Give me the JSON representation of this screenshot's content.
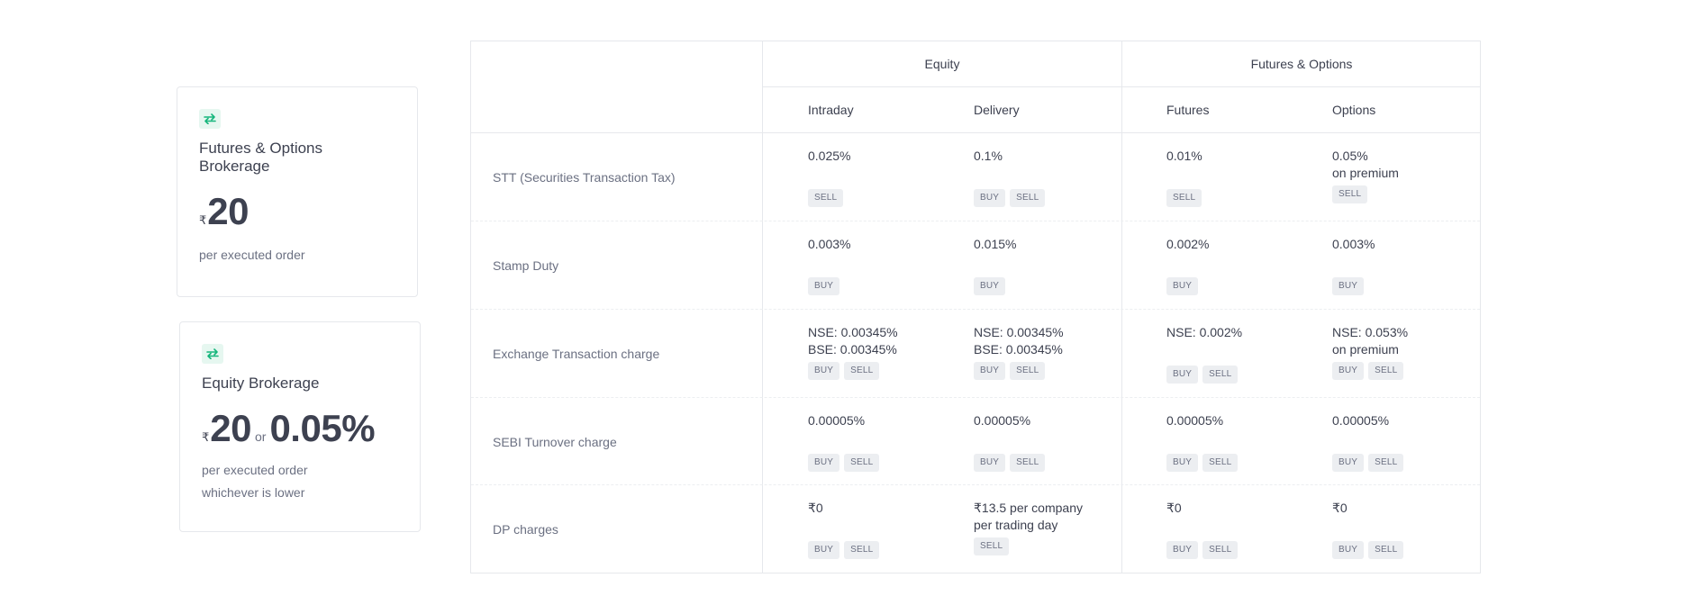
{
  "colors": {
    "accent": "#16b67c",
    "icon_bg": "#e6f7f0",
    "text": "#3d4150",
    "muted": "#6b7082",
    "tag_bg": "#eceef1"
  },
  "cards": {
    "fo": {
      "icon": "swap-arrows-icon",
      "title": "Futures & Options Brokerage",
      "currency": "₹",
      "amount": "20",
      "sub1": "per executed order"
    },
    "equity": {
      "icon": "swap-arrows-icon",
      "title": "Equity Brokerage",
      "currency": "₹",
      "amount": "20",
      "or": "or",
      "percent": "0.05%",
      "sub1": "per executed order",
      "sub2": "whichever is lower"
    }
  },
  "table": {
    "groups": [
      "Equity",
      "Futures & Options"
    ],
    "columns": [
      "Intraday",
      "Delivery",
      "Futures",
      "Options"
    ],
    "rows": [
      {
        "label": "STT (Securities Transaction Tax)",
        "cells": [
          {
            "line1": "0.025%",
            "line2": "",
            "tags": [
              "SELL"
            ]
          },
          {
            "line1": "0.1%",
            "line2": "",
            "tags": [
              "BUY",
              "SELL"
            ]
          },
          {
            "line1": "0.01%",
            "line2": "",
            "tags": [
              "SELL"
            ]
          },
          {
            "line1": "0.05%",
            "line2": "on premium",
            "tags": [
              "SELL"
            ]
          }
        ]
      },
      {
        "label": "Stamp Duty",
        "cells": [
          {
            "line1": "0.003%",
            "line2": "",
            "tags": [
              "BUY"
            ]
          },
          {
            "line1": "0.015%",
            "line2": "",
            "tags": [
              "BUY"
            ]
          },
          {
            "line1": "0.002%",
            "line2": "",
            "tags": [
              "BUY"
            ]
          },
          {
            "line1": "0.003%",
            "line2": "",
            "tags": [
              "BUY"
            ]
          }
        ]
      },
      {
        "label": "Exchange Transaction charge",
        "cells": [
          {
            "line1": "NSE: 0.00345%",
            "line2": "BSE: 0.00345%",
            "tags": [
              "BUY",
              "SELL"
            ]
          },
          {
            "line1": "NSE: 0.00345%",
            "line2": "BSE: 0.00345%",
            "tags": [
              "BUY",
              "SELL"
            ]
          },
          {
            "line1": "NSE: 0.002%",
            "line2": "",
            "tags": [
              "BUY",
              "SELL"
            ]
          },
          {
            "line1": "NSE: 0.053%",
            "line2": "on premium",
            "tags": [
              "BUY",
              "SELL"
            ]
          }
        ]
      },
      {
        "label": "SEBI Turnover charge",
        "cells": [
          {
            "line1": "0.00005%",
            "line2": "",
            "tags": [
              "BUY",
              "SELL"
            ]
          },
          {
            "line1": "0.00005%",
            "line2": "",
            "tags": [
              "BUY",
              "SELL"
            ]
          },
          {
            "line1": "0.00005%",
            "line2": "",
            "tags": [
              "BUY",
              "SELL"
            ]
          },
          {
            "line1": "0.00005%",
            "line2": "",
            "tags": [
              "BUY",
              "SELL"
            ]
          }
        ]
      },
      {
        "label": "DP charges",
        "cells": [
          {
            "line1": "₹0",
            "line2": "",
            "tags": [
              "BUY",
              "SELL"
            ]
          },
          {
            "line1": "₹13.5 per company",
            "line2": "per trading day",
            "tags": [
              "SELL"
            ]
          },
          {
            "line1": "₹0",
            "line2": "",
            "tags": [
              "BUY",
              "SELL"
            ]
          },
          {
            "line1": "₹0",
            "line2": "",
            "tags": [
              "BUY",
              "SELL"
            ]
          }
        ]
      }
    ]
  }
}
